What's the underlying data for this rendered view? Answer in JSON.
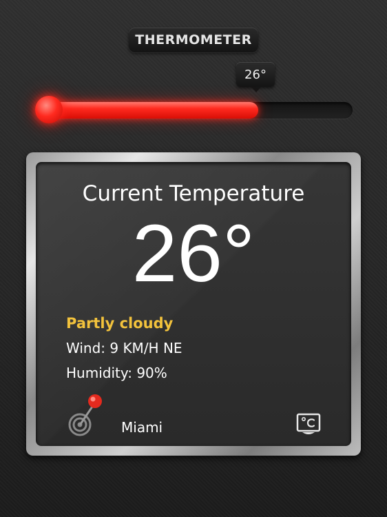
{
  "app": {
    "title": "THERMOMETER"
  },
  "slider": {
    "value_label": "26°",
    "fill_fraction": 0.7,
    "color": "#ff2a1f"
  },
  "card": {
    "heading": "Current Temperature",
    "temperature": "26°",
    "condition": "Partly cloudy",
    "condition_color": "#f2c23c",
    "wind": "Wind: 9 KM/H NE",
    "humidity": "Humidity: 90%",
    "city": "Miami",
    "location_icon": "location-pin-radar-icon",
    "unit_icon": "celsius-unit-icon"
  }
}
